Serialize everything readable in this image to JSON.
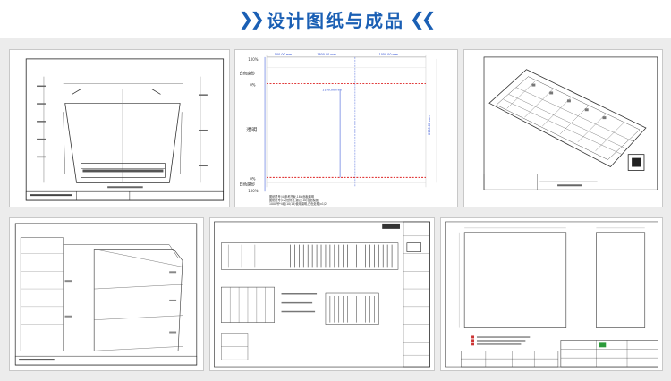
{
  "header": {
    "title": "设计图纸与成品",
    "left_chevrons": "❯❯",
    "right_chevrons": "❮❮",
    "accent_color": "#1a5fb4"
  },
  "panel_glass": {
    "dims_top": [
      "500.00 mm",
      "1600.00 mm",
      "1050.00 mm"
    ],
    "dim_inner": "1100.00 mm",
    "dim_vertical": "2300.00 mm",
    "pct_labels": [
      "100%",
      "0%",
      "0%",
      "100%"
    ],
    "left_labels": [
      "白色磨砂",
      "透明",
      "白色磨砂"
    ],
    "notes": [
      "图纸尾号(4)参考托坂,18#面板磨明",
      "图纸尾号(12)色修复,通过(10)自色模板",
      "1000号*4组(10/18)使用磨明,白色处理(x1/2)",
      "1000号*4组(10/18)使用磨明,白色处理(x1/2)"
    ]
  }
}
